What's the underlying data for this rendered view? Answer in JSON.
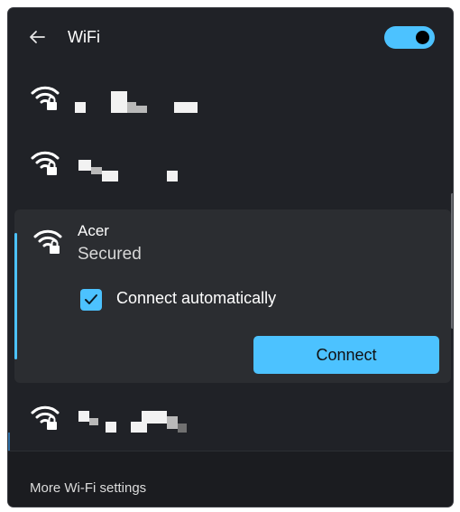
{
  "header": {
    "back_icon": "back-arrow-icon",
    "title": "WiFi",
    "toggle_on": true
  },
  "networks": [
    {
      "icon": "wifi-secured-icon",
      "name_redacted": true
    },
    {
      "icon": "wifi-secured-icon",
      "name_redacted": true
    },
    {
      "icon": "wifi-secured-icon",
      "name_redacted": true
    }
  ],
  "expanded": {
    "icon": "wifi-secured-icon",
    "ssid": "Acer",
    "status": "Secured",
    "auto_connect_label": "Connect automatically",
    "auto_connect_checked": true,
    "connect_label": "Connect"
  },
  "footer": {
    "link": "More Wi-Fi settings"
  },
  "colors": {
    "panel_bg": "#202227",
    "expanded_bg": "#2b2d31",
    "accent": "#4cc2ff",
    "footer_bg": "#1b1c20"
  }
}
